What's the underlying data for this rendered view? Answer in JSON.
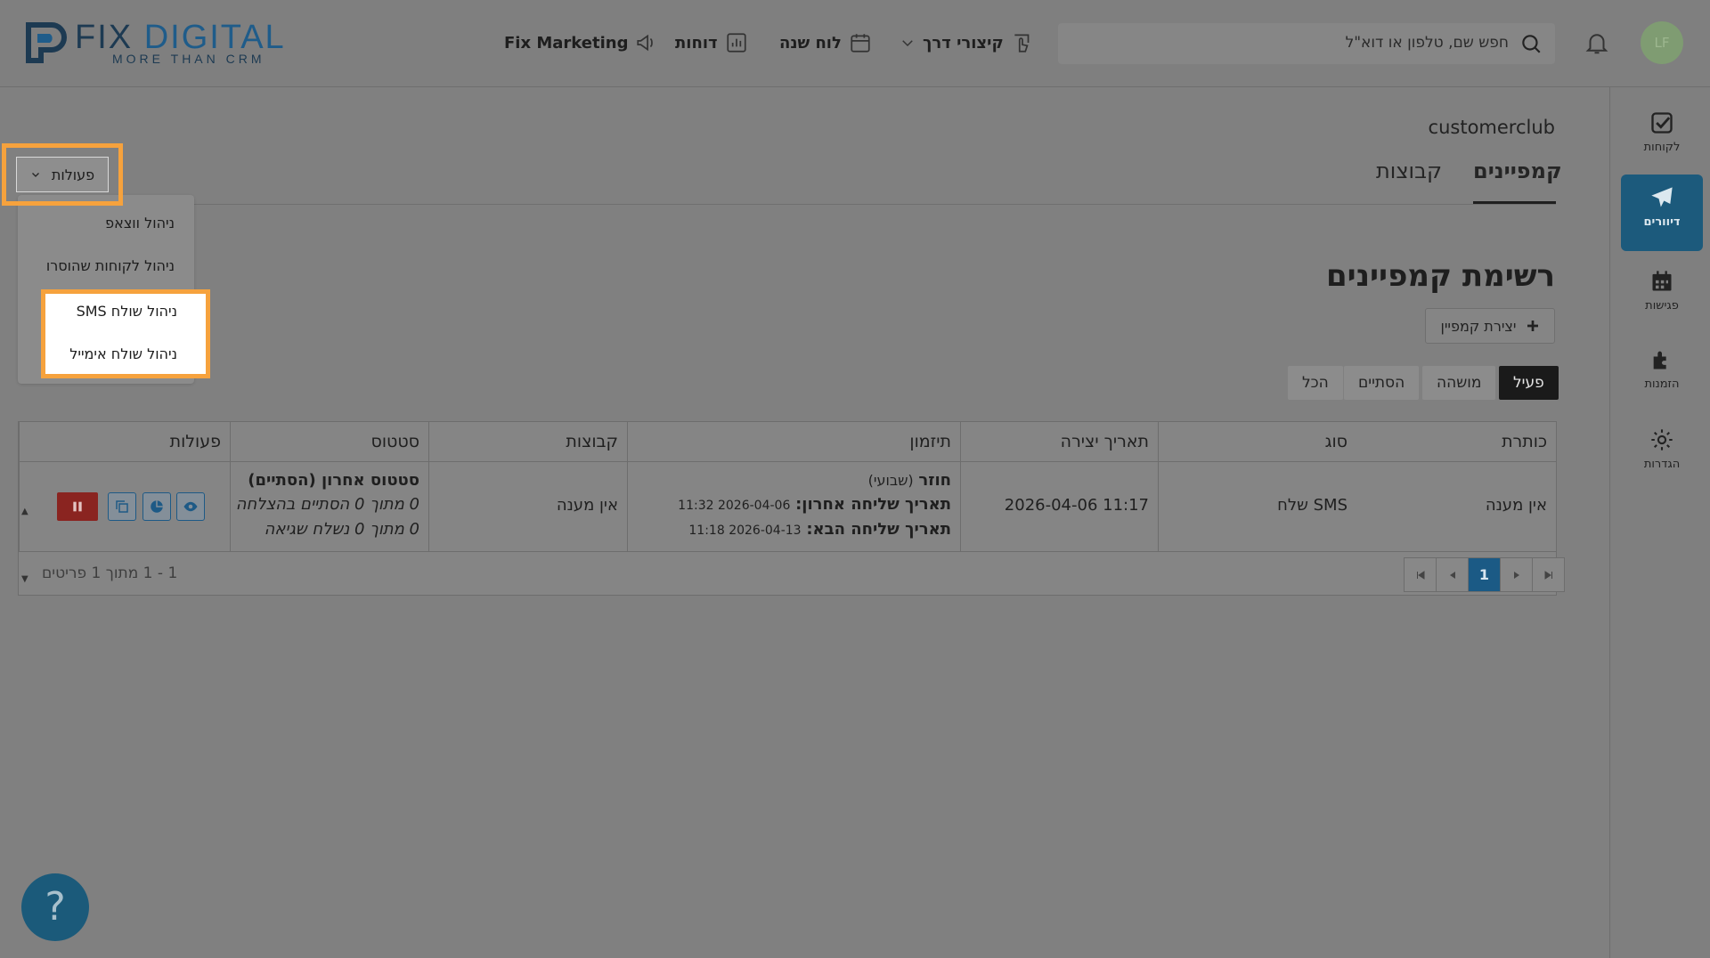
{
  "brand": {
    "name_a": "FIX ",
    "name_b": "DIGITAL",
    "tagline": "MORE THAN CRM"
  },
  "nav": {
    "marketing": "Fix Marketing",
    "reports": "דוחות",
    "calendar": "לוח שנה",
    "shortcuts": "קיצורי דרך"
  },
  "search": {
    "placeholder": "חפש שם, טלפון או דוא\"ל"
  },
  "user": {
    "initials": "LF"
  },
  "sidebar": [
    {
      "label": "לקוחות",
      "icon": "check-square-icon"
    },
    {
      "label": "דיוורים",
      "icon": "paper-plane-icon",
      "active": true
    },
    {
      "label": "פגישות",
      "icon": "calendar-icon"
    },
    {
      "label": "הזמנות",
      "icon": "puzzle-icon"
    },
    {
      "label": "הגדרות",
      "icon": "gear-icon"
    }
  ],
  "org_name": "customerclub",
  "tabs": [
    {
      "label": "קמפיינים",
      "active": true
    },
    {
      "label": "קבוצות",
      "active": false
    }
  ],
  "page_title": "רשימת קמפיינים",
  "create_button": "יצירת קמפיין",
  "filters": [
    {
      "label": "פעיל",
      "active": true
    },
    {
      "label": "מושהה",
      "active": false
    },
    {
      "label": "הסתיים",
      "active": false
    },
    {
      "label": "הכל",
      "active": false
    }
  ],
  "table": {
    "headers": [
      "כותרת",
      "סוג",
      "תאריך יצירה",
      "תיזמון",
      "קבוצות",
      "סטטוס",
      "פעולות"
    ],
    "rows": [
      {
        "title": "אין מענה",
        "type": "שלח SMS",
        "created": "2026-04-06 11:17",
        "schedule_kind": "חוזר",
        "schedule_freq": "(שבועי)",
        "last_sent_label": "תאריך שליחה אחרון:",
        "last_sent": "2026-04-06 11:32",
        "next_sent_label": "תאריך שליחה הבא:",
        "next_sent": "2026-04-13 11:18",
        "groups": "אין מענה",
        "status_title": "סטטוס אחרון (הסתיים)",
        "status_success": "0 מתוך 0 הסתיים בהצלחה",
        "status_error": "0 מתוך 0 נשלח שגיאה"
      }
    ],
    "page_current": "1",
    "count_text": "1 - 1 מתוך 1 פריטים"
  },
  "actions_menu": {
    "button": "פעולות",
    "items": [
      "ניהול ווצאפ",
      "ניהול לקוחות שהוסרו",
      "ניהול שולח SMS",
      "ניהול שולח אימייל"
    ]
  },
  "help_label": "?",
  "colors": {
    "accent": "#1c5a7c",
    "highlight": "#f6a23d",
    "danger": "#8a2420"
  }
}
